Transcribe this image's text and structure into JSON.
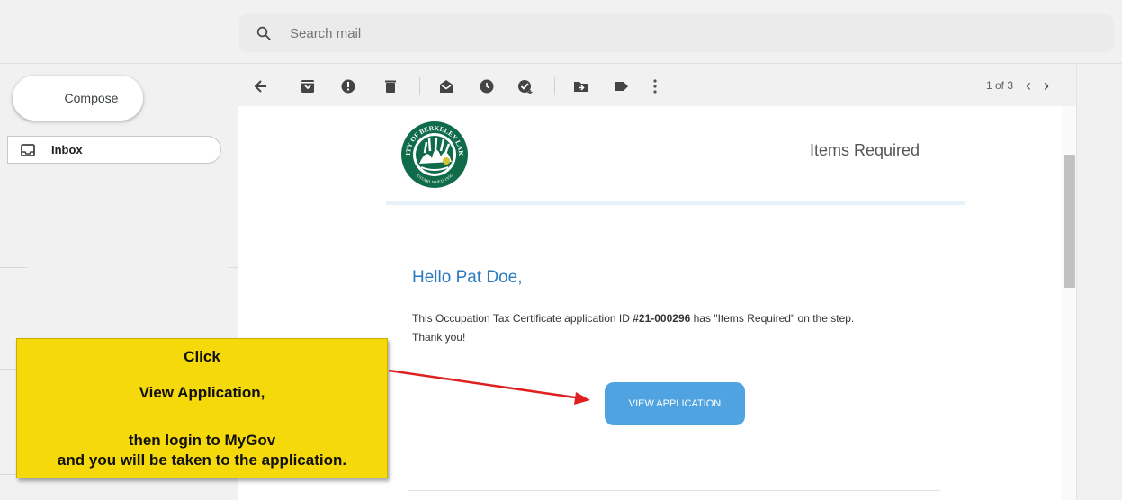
{
  "search": {
    "placeholder": "Search mail"
  },
  "sidebar": {
    "compose_label": "Compose",
    "inbox_label": "Inbox"
  },
  "toolbar": {
    "icons": [
      "back-arrow-icon",
      "archive-icon",
      "report-spam-icon",
      "delete-icon",
      "mark-unread-icon",
      "snooze-icon",
      "add-to-tasks-icon",
      "move-to-icon",
      "labels-icon",
      "more-icon"
    ],
    "pager": {
      "count": "1 of 3"
    }
  },
  "email": {
    "header_title": "Items Required",
    "greeting": "Hello Pat Doe,",
    "body_prefix": "This Occupation Tax Certificate application ID ",
    "application_id": "#21-000296",
    "body_suffix": " has \"Items Required\" on the step.",
    "thanks": "Thank you!",
    "button_label": "VIEW APPLICATION",
    "logo_top_text": "CITY OF BERKELEY LAKE",
    "logo_bottom_text": "ESTABLISHED 1956"
  },
  "callout": {
    "line1": "Click",
    "line2": "View Application,",
    "line3": "then login to MyGov",
    "line4": "and you will be taken to the application."
  },
  "colors": {
    "accent_button": "#4fa3e0",
    "greeting": "#2b7ac0",
    "callout": "#f5d90a",
    "arrow": "#e02020",
    "logo_green": "#0f6b4a"
  }
}
